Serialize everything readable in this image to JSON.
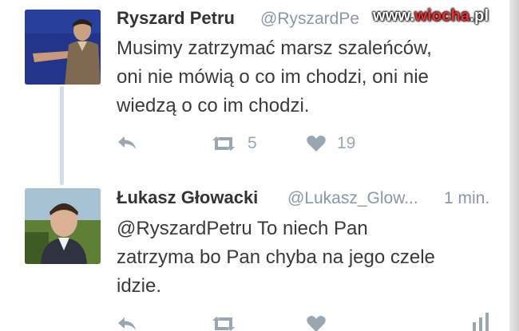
{
  "watermark": {
    "text_before": "www.",
    "brand": "wiocha",
    "text_after": ".pl"
  },
  "tweets": [
    {
      "author_name": "Ryszard Petru",
      "handle": "@RyszardPe",
      "time": "",
      "body_lines": [
        "Musimy zatrzymać marsz szaleńców,",
        "oni nie mówią o co im chodzi, oni nie",
        "wiedzą o co im chodzi."
      ],
      "retweet_count": "5",
      "like_count": "19"
    },
    {
      "author_name": "Łukasz Głowacki",
      "handle": "@Lukasz_Glow...",
      "time": "1 min.",
      "body_lines": [
        "@RyszardPetru To niech Pan",
        "zatrzyma bo Pan chyba na jego czele",
        "idzie."
      ],
      "retweet_count": "",
      "like_count": ""
    }
  ],
  "icons": {
    "reply": "reply-icon",
    "retweet": "retweet-icon",
    "like": "heart-icon",
    "analytics": "analytics-icon"
  },
  "colors": {
    "name": "#333333",
    "meta": "#8899a6",
    "body": "#3a3a3a",
    "action": "#9aa7b2",
    "watermark_accent": "#ff2b2b"
  }
}
